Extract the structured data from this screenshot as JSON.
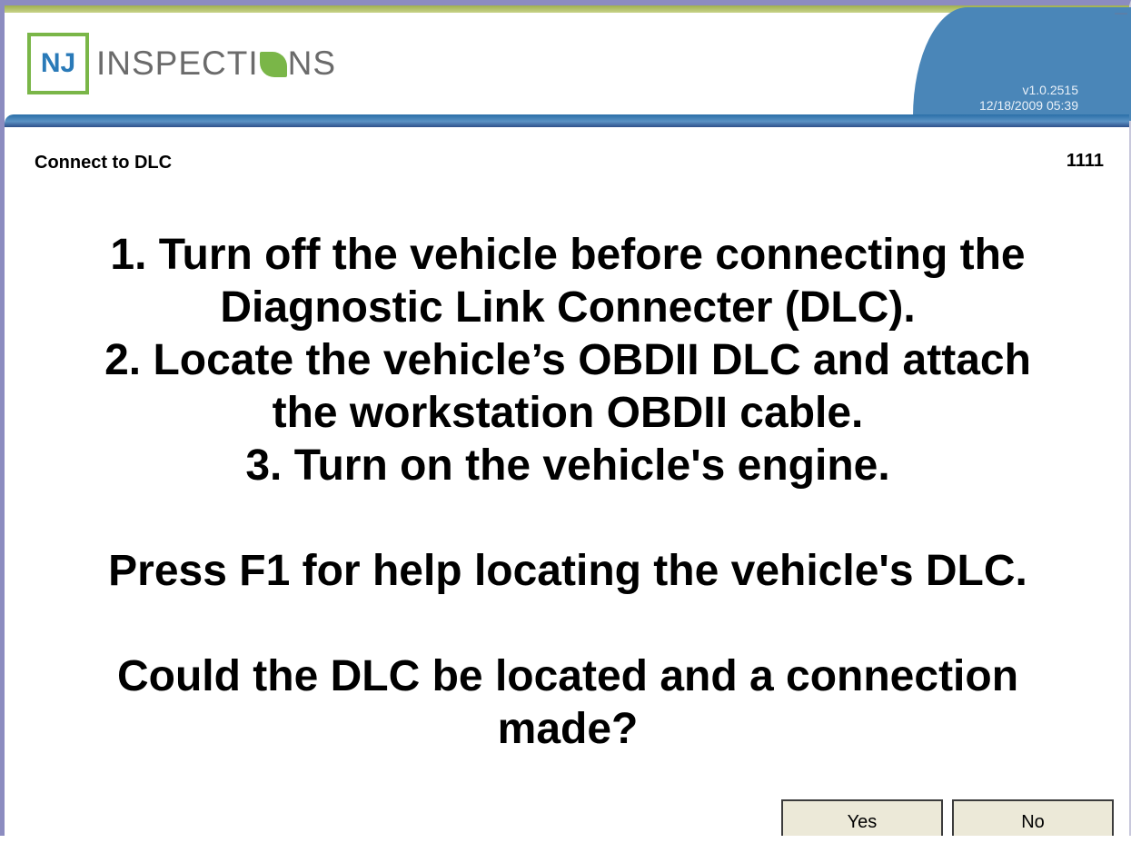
{
  "header": {
    "logo_prefix": "NJ",
    "logo_word_start": "INSPECTI",
    "logo_word_end": "NS",
    "version": "v1.0.2515",
    "datetime": "12/18/2009 05:39"
  },
  "screen": {
    "title": "Connect to DLC",
    "code": "1111"
  },
  "message": {
    "lines": [
      "1. Turn off the vehicle before connecting the",
      "Diagnostic Link Connecter (DLC).",
      "2. Locate the vehicle’s OBDII DLC and attach",
      "the workstation OBDII cable.",
      "3. Turn on the vehicle's engine."
    ],
    "help": "Press F1 for help locating the vehicle's DLC.",
    "question_line1": "Could the DLC be located and a connection",
    "question_line2": "made?"
  },
  "buttons": {
    "yes": "Yes",
    "no": "No"
  },
  "colors": {
    "brand_green": "#7ab648",
    "brand_blue": "#2a7ab8",
    "header_blue": "#4a86b8",
    "button_face": "#ece9d8"
  }
}
